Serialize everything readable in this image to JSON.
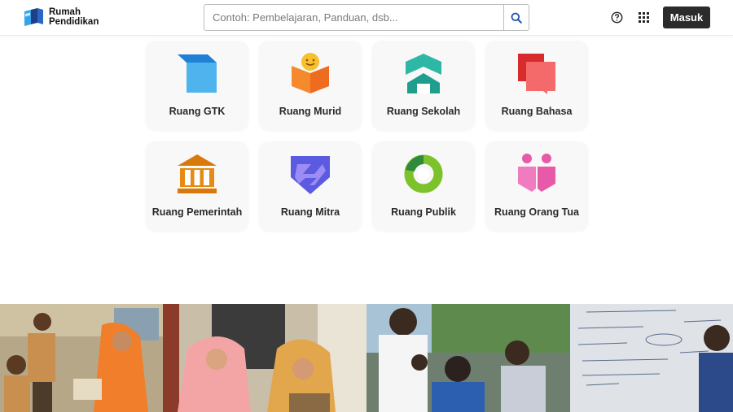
{
  "header": {
    "logo": {
      "line1": "Rumah",
      "line2": "Pendidikan"
    },
    "search": {
      "placeholder": "Contoh: Pembelajaran, Panduan, dsb..."
    },
    "login_label": "Masuk",
    "icons": {
      "search": "search-icon",
      "help": "help-icon",
      "apps": "apps-grid-icon"
    }
  },
  "cards": [
    {
      "label": "Ruang GTK",
      "icon": "ruang-gtk-icon"
    },
    {
      "label": "Ruang Murid",
      "icon": "ruang-murid-icon"
    },
    {
      "label": "Ruang Sekolah",
      "icon": "ruang-sekolah-icon"
    },
    {
      "label": "Ruang Bahasa",
      "icon": "ruang-bahasa-icon"
    },
    {
      "label": "Ruang Pemerintah",
      "icon": "ruang-pemerintah-icon"
    },
    {
      "label": "Ruang Mitra",
      "icon": "ruang-mitra-icon"
    },
    {
      "label": "Ruang Publik",
      "icon": "ruang-publik-icon"
    },
    {
      "label": "Ruang Orang Tua",
      "icon": "ruang-orang-tua-icon"
    }
  ],
  "colors": {
    "gtk": "#4fb4ee",
    "murid": "#f58a2c",
    "sekolah": "#24a89a",
    "bahasa": "#ef4b4b",
    "pemerintah": "#e58a12",
    "mitra": "#5a5be0",
    "publik": "#5ea52a",
    "orang_tua": "#e65aa8",
    "login_bg": "#2b2b2b"
  }
}
